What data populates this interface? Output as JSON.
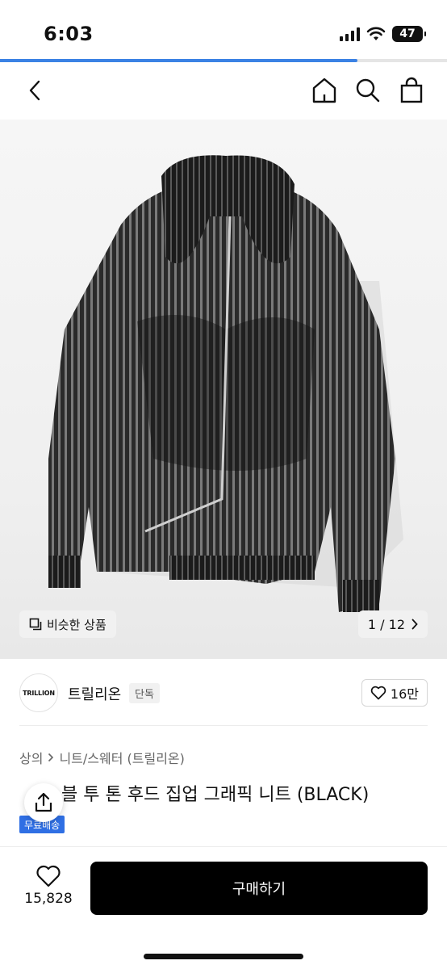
{
  "status_bar": {
    "time": "6:03",
    "battery": "47"
  },
  "progress": {
    "fraction": 0.8
  },
  "nav": {
    "back": "back",
    "icons": [
      "home-icon",
      "search-icon",
      "shopping-bag-icon"
    ]
  },
  "product": {
    "similar_label": "비슷한 상품",
    "page_indicator": "1 / 12",
    "brand_name": "트릴리온",
    "brand_badge": "단독",
    "brand_logo_text": "TRILLION",
    "likes": "16만",
    "breadcrumb": [
      "상의",
      "니트/스웨터 (트릴리온)"
    ],
    "title": "블 투 톤 후드 집업 그래픽 니트 (BLACK)",
    "free_shipping": "무료배송"
  },
  "bottom": {
    "wish_count": "15,828",
    "buy_label": "구매하기"
  },
  "colors": {
    "accent": "#3b82e4",
    "buy_button": "#000000",
    "free_ship": "#2f6fe4"
  }
}
